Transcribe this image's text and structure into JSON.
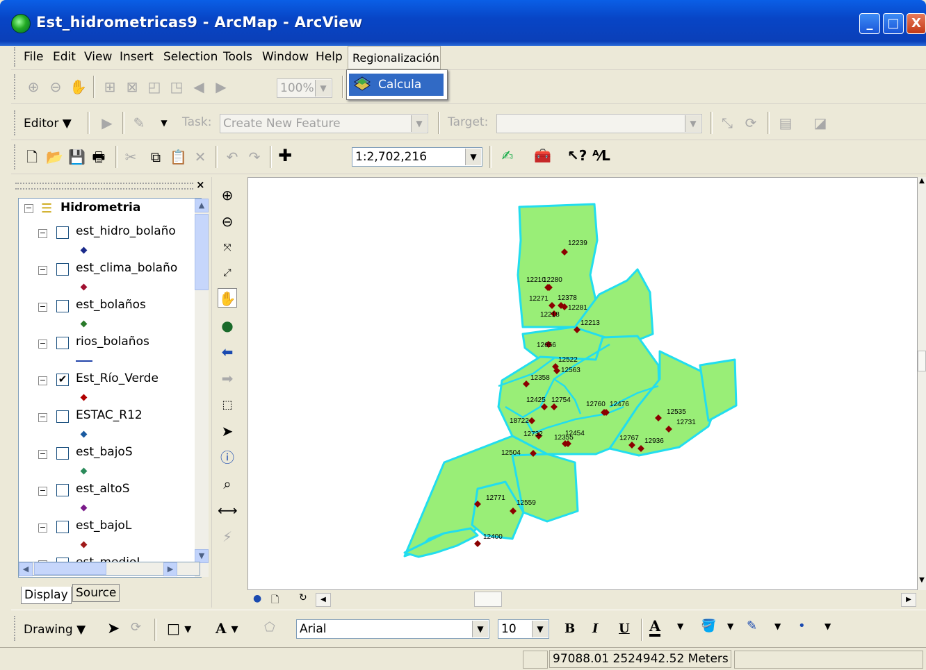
{
  "window": {
    "title": "Est_hidrometricas9 - ArcMap - ArcView"
  },
  "menubar": {
    "items": [
      "File",
      "Edit",
      "View",
      "Insert",
      "Selection",
      "Tools",
      "Window",
      "Help"
    ],
    "regionalizacion": "Regionalización"
  },
  "dropdown": {
    "item": "Calcula"
  },
  "standard_toolbar": {
    "zoom_pct": "100%"
  },
  "editor_toolbar": {
    "editor_label": "Editor",
    "task_label": "Task:",
    "task_value": "Create New Feature",
    "target_label": "Target:",
    "target_value": ""
  },
  "main_toolbar": {
    "scale": "1:2,702,216"
  },
  "toc": {
    "root": "Hidrometria",
    "layers": [
      {
        "name": "est_hidro_bolaño",
        "checked": false,
        "symbol": "#1a2a8a"
      },
      {
        "name": "est_clima_bolaño",
        "checked": false,
        "symbol": "#a01030"
      },
      {
        "name": "est_bolaños",
        "checked": false,
        "symbol": "#2a7a2a"
      },
      {
        "name": "rios_bolaños",
        "checked": false,
        "symbol": "line"
      },
      {
        "name": "Est_Río_Verde",
        "checked": true,
        "symbol": "#b00000"
      },
      {
        "name": "ESTAC_R12",
        "checked": false,
        "symbol": "#1a5aa0"
      },
      {
        "name": "est_bajoS",
        "checked": false,
        "symbol": "#2a8a5a"
      },
      {
        "name": "est_altoS",
        "checked": false,
        "symbol": "#7a1a8a"
      },
      {
        "name": "est_bajoL",
        "checked": false,
        "symbol": "#a01a1a"
      },
      {
        "name": "est_medioL",
        "checked": false,
        "symbol": "#444"
      }
    ],
    "tabs": {
      "display": "Display",
      "source": "Source"
    }
  },
  "map": {
    "fill_color": "#99ee77",
    "border_color": "#22ddee",
    "station_color": "#8b0000",
    "labels": [
      "12239",
      "12210",
      "12280",
      "12271",
      "12378",
      "12281",
      "12218",
      "12213",
      "12656",
      "12522",
      "12563",
      "12358",
      "12425",
      "12754",
      "12760",
      "12476",
      "12535",
      "18722",
      "12731",
      "12732",
      "12355",
      "12454",
      "12767",
      "12936",
      "12504",
      "12771",
      "12559",
      "12400"
    ]
  },
  "drawing_toolbar": {
    "drawing_label": "Drawing",
    "font": "Arial",
    "size": "10",
    "bold": "B",
    "italic": "I",
    "underline": "U",
    "font_color": "A"
  },
  "status": {
    "coords": "97088.01  2524942.52 Meters"
  }
}
